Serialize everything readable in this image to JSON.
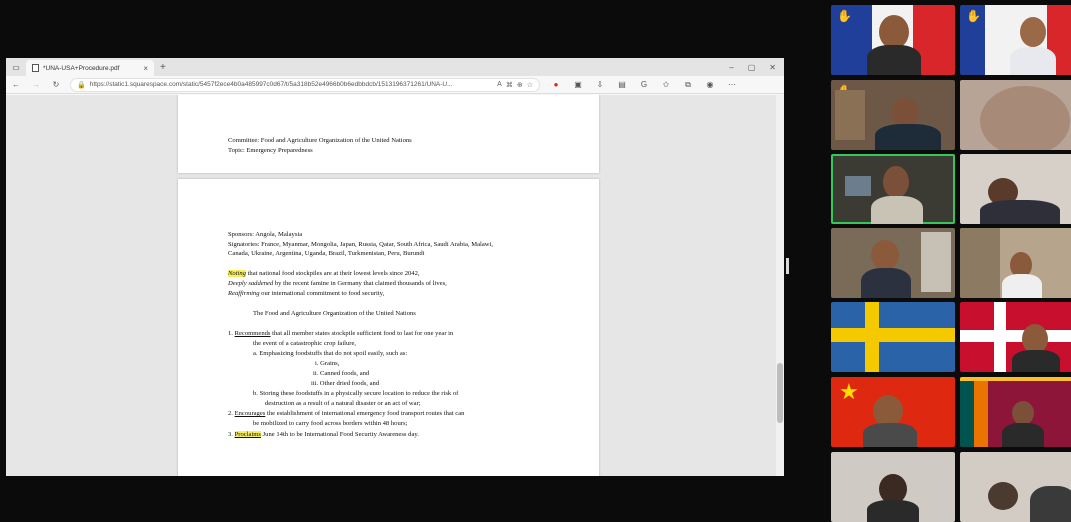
{
  "browser": {
    "tab_title": "*UNA-USA+Procedure.pdf",
    "url": "https://static1.squarespace.com/static/5457f2ece4b0a485997c0d67/t/5a318b52e4966b0b6edbbdcb/1513196371261/UNA-U..."
  },
  "document": {
    "page1": {
      "committee": "Committee: Food and Agriculture Organization of the United Nations",
      "topic": "Topic: Emergency Preparedness"
    },
    "page2": {
      "sponsors": "Sponsors: Angola, Malaysia",
      "signatories_1": "Signatories: France, Myanmar, Mongolia, Japan, Russia, Qatar, South Africa, Saudi Arabia, Malawi,",
      "signatories_2": "Canada, Ukraine, Argentina, Uganda, Brazil, Turkmenistan, Peru, Burundi",
      "pre1_kw": "Noting",
      "pre1_rest": " that national food stockpiles are at their lowest levels since 2042,",
      "pre2_kw": "Deeply saddened",
      "pre2_rest": " by the recent famine in Germany that claimed thousands of lives,",
      "pre3_kw": "Reaffirming",
      "pre3_rest": " our international commitment to food security,",
      "body_name": "The Food and Agriculture Organization of the United Nations",
      "c1_num": "1. ",
      "c1_kw": "Recommends",
      "c1_rest": " that all member states stockpile sufficient food to last for one year in",
      "c1_cont": "the event of a catastrophic crop failure,",
      "c1a": "a.   Emphasizing foodstuffs that do not spoil easily, such as:",
      "c1a_i": "i.   Grains,",
      "c1a_ii": "ii.   Canned foods, and",
      "c1a_iii": "iii.   Other dried foods, and",
      "c1b": "b.   Storing these foodstuffs in a physically secure location to reduce the risk of",
      "c1b_cont": "destruction as a result of a natural disaster or an act of war;",
      "c2_num": "2. ",
      "c2_kw": "Encourages",
      "c2_rest": " the establishment of international emergency food transport routes that can",
      "c2_cont": "be mobilized to carry food across borders within 48 hours;",
      "c3_num": "3. ",
      "c3_kw": "Proclaims",
      "c3_rest": " June 14th to be International Food Security Awareness day."
    }
  },
  "participants": [
    {
      "id": "p1",
      "raised_hand": true,
      "background": "France flag"
    },
    {
      "id": "p2",
      "raised_hand": true,
      "background": "France flag"
    },
    {
      "id": "p3",
      "raised_hand": true,
      "background": "room"
    },
    {
      "id": "p4",
      "raised_hand": false,
      "background": "close-up"
    },
    {
      "id": "p5",
      "raised_hand": false,
      "background": "room",
      "active_speaker": true
    },
    {
      "id": "p6",
      "raised_hand": false,
      "background": "room"
    },
    {
      "id": "p7",
      "raised_hand": false,
      "background": "room"
    },
    {
      "id": "p8",
      "raised_hand": false,
      "background": "room"
    },
    {
      "id": "p9",
      "raised_hand": false,
      "background": "Sweden flag"
    },
    {
      "id": "p10",
      "raised_hand": false,
      "background": "Denmark flag"
    },
    {
      "id": "p11",
      "raised_hand": false,
      "background": "China flag"
    },
    {
      "id": "p12",
      "raised_hand": false,
      "background": "Sri Lanka flag"
    },
    {
      "id": "p13",
      "raised_hand": false,
      "background": "room"
    },
    {
      "id": "p14",
      "raised_hand": false,
      "background": "room"
    }
  ],
  "colors": {
    "highlight": "#f6ee60",
    "active_speaker_border": "#34c759",
    "raise_hand": "#f5c400"
  }
}
